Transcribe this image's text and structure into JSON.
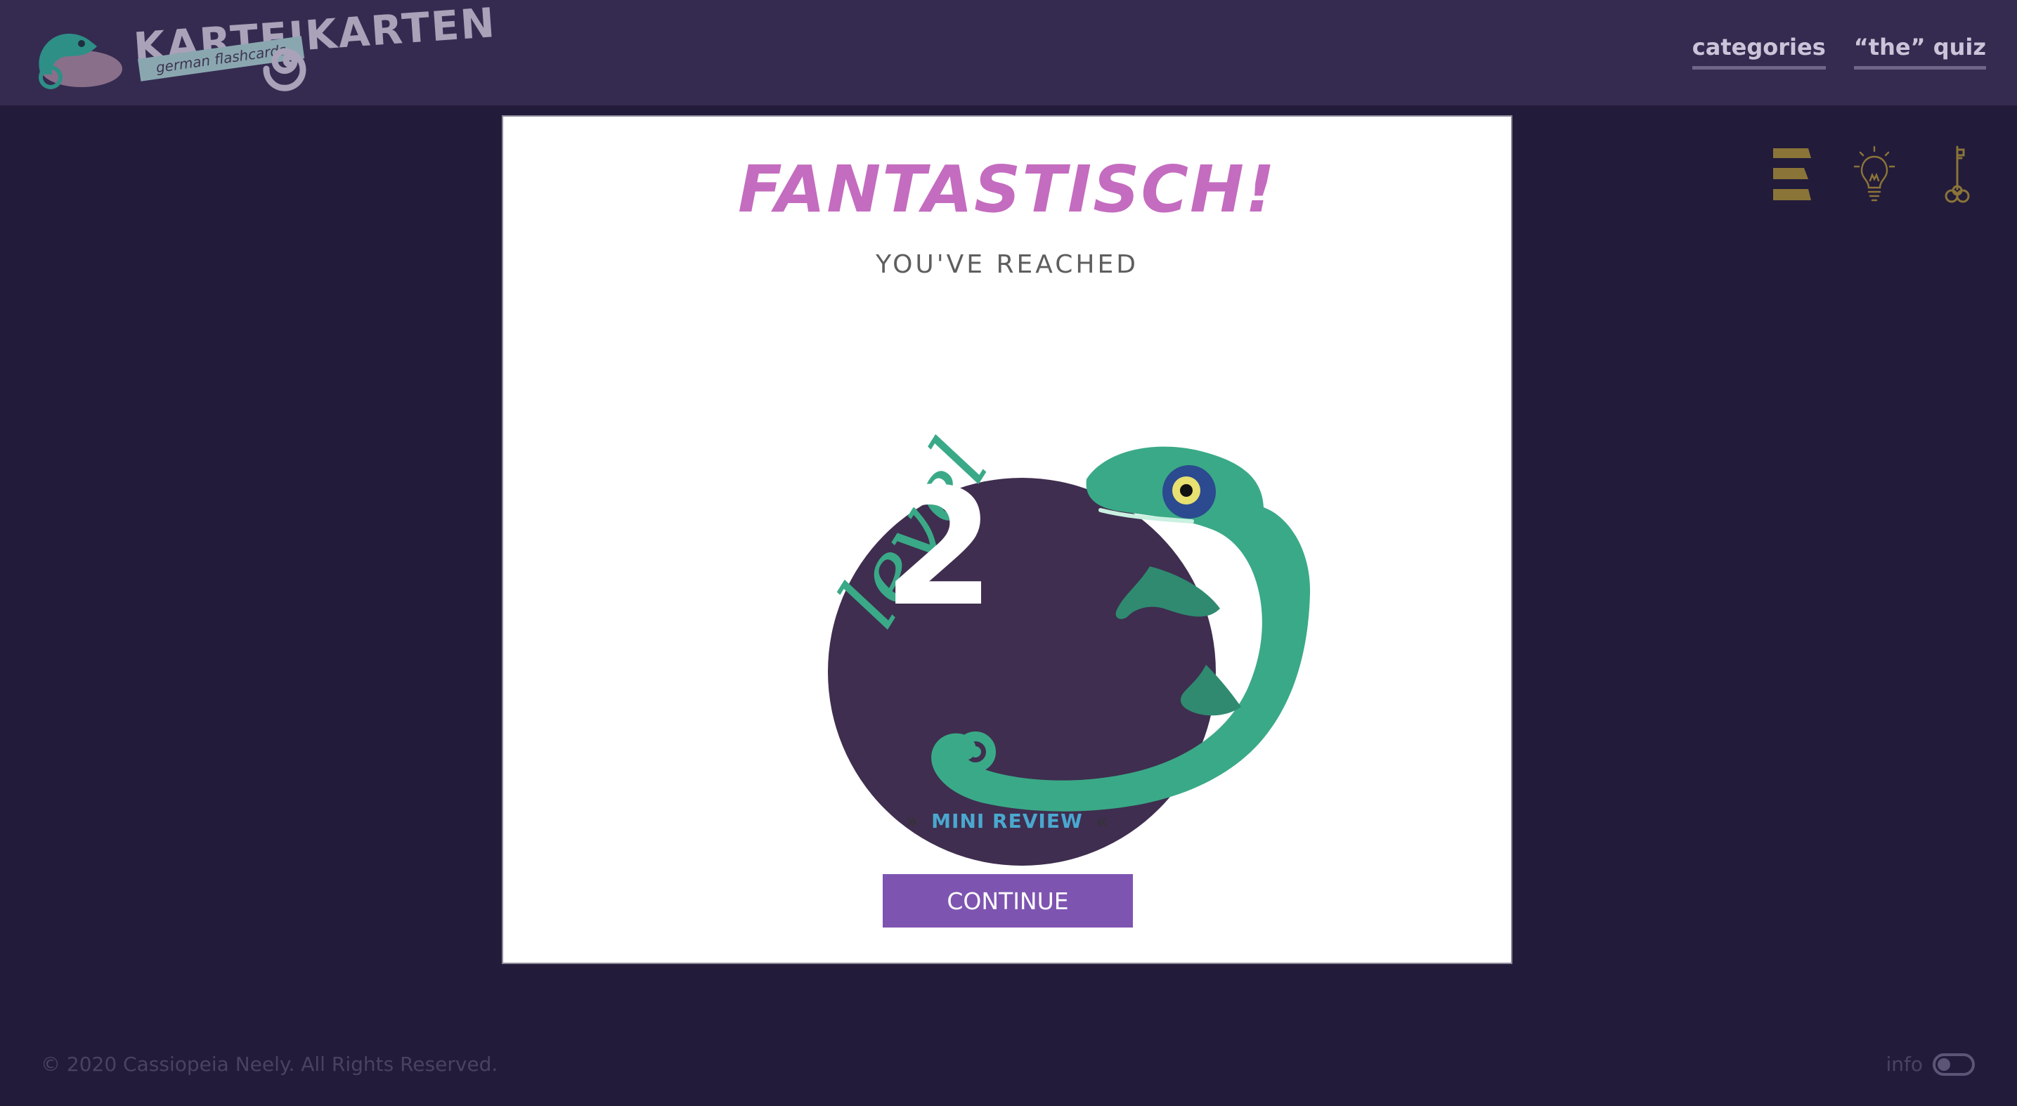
{
  "brand": {
    "title": "KARTEIKARTEN",
    "tagline": "german flashcards"
  },
  "nav": {
    "categories": "categories",
    "quiz": "“the” quiz"
  },
  "tools": [
    "flashcard-stack-icon",
    "lightbulb-icon",
    "key-icon"
  ],
  "modal": {
    "title": "FANTASTISCH!",
    "subtitle": "YOU'VE REACHED",
    "level_script": "level",
    "level_number": "2",
    "mini_review": "MINI REVIEW",
    "continue_label": "CONTINUE"
  },
  "footer": {
    "copyright": "© 2020 Cassiopeia Neely. All Rights Reserved.",
    "info_label": "info",
    "info_toggle_on": false
  },
  "colors": {
    "background": "#221b3a",
    "header": "#352b50",
    "title": "#c46cbf",
    "accent_teal": "#3aa987",
    "circle": "#3f2e4f",
    "button": "#7e54b1",
    "review_link": "#4aa8cf",
    "tool_gold": "#8a7438"
  }
}
